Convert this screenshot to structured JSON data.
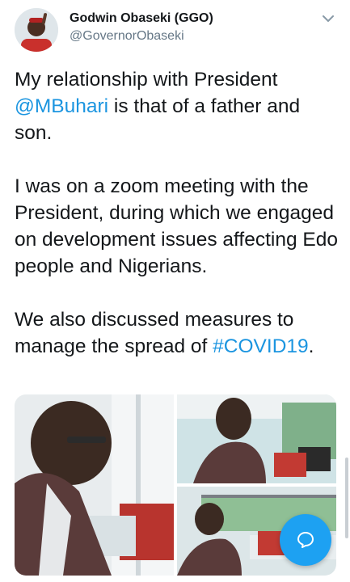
{
  "tweet": {
    "author_name": "Godwin Obaseki (GGO)",
    "author_handle": "@GovernorObaseki",
    "para1_before": "My relationship with President ",
    "para1_mention": "@MBuhari",
    "para1_after": " is that of a father and son.",
    "para2": "I was on a zoom meeting with the President, during which we engaged on development issues affecting Edo people and Nigerians.",
    "para3_before": "We also discussed measures to manage the spread of ",
    "para3_hashtag": "#COVID19",
    "para3_after": "."
  },
  "icons": {
    "menu": "chevron-down-icon",
    "compose": "chat-bubble-icon"
  },
  "colors": {
    "link": "#1b95e0",
    "fab": "#1da1f2",
    "secondary_text": "#657786"
  }
}
